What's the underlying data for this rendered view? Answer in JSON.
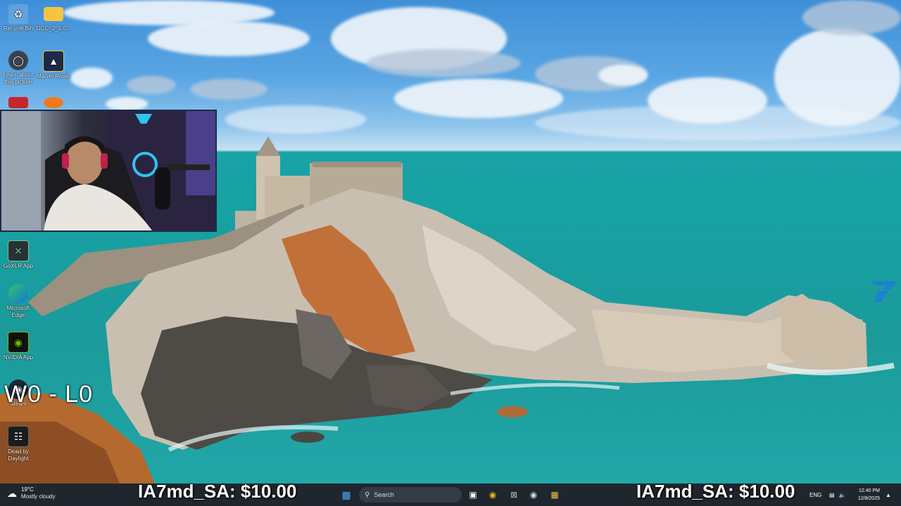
{
  "desktop": {
    "icons": [
      {
        "label": "Recycle Bin",
        "icon": "recycle-bin-icon"
      },
      {
        "label": "GCC_2_1.0...",
        "icon": "folder-icon"
      },
      {
        "label": "Learn about this picture",
        "icon": "learn-icon"
      },
      {
        "label": "Marvel Rivals",
        "icon": "marvel-rivals-icon"
      },
      {
        "label": "GoXLR App",
        "icon": "goxlr-icon"
      },
      {
        "label": "Microsoft Edge",
        "icon": "edge-icon"
      },
      {
        "label": "NVIDIA App",
        "icon": "nvidia-icon"
      },
      {
        "label": "Steam",
        "icon": "steam-icon"
      },
      {
        "label": "Dead by Daylight",
        "icon": "dead-by-daylight-icon"
      }
    ]
  },
  "overlay": {
    "score": "W0 - L0",
    "donation_left": "IA7md_SA: $10.00",
    "donation_right": "IA7md_SA: $10.00"
  },
  "taskbar": {
    "weather_temp": "19°C",
    "weather_desc": "Mostly cloudy",
    "search_placeholder": "Search",
    "language": "ENG",
    "time": "12:40 PM",
    "date": "12/8/2025"
  },
  "colors": {
    "taskbar_bg": "#1f262e",
    "sea": "#17a1a3",
    "sky": "#3f8fd8",
    "brand_accent": "#1e7bd8"
  }
}
